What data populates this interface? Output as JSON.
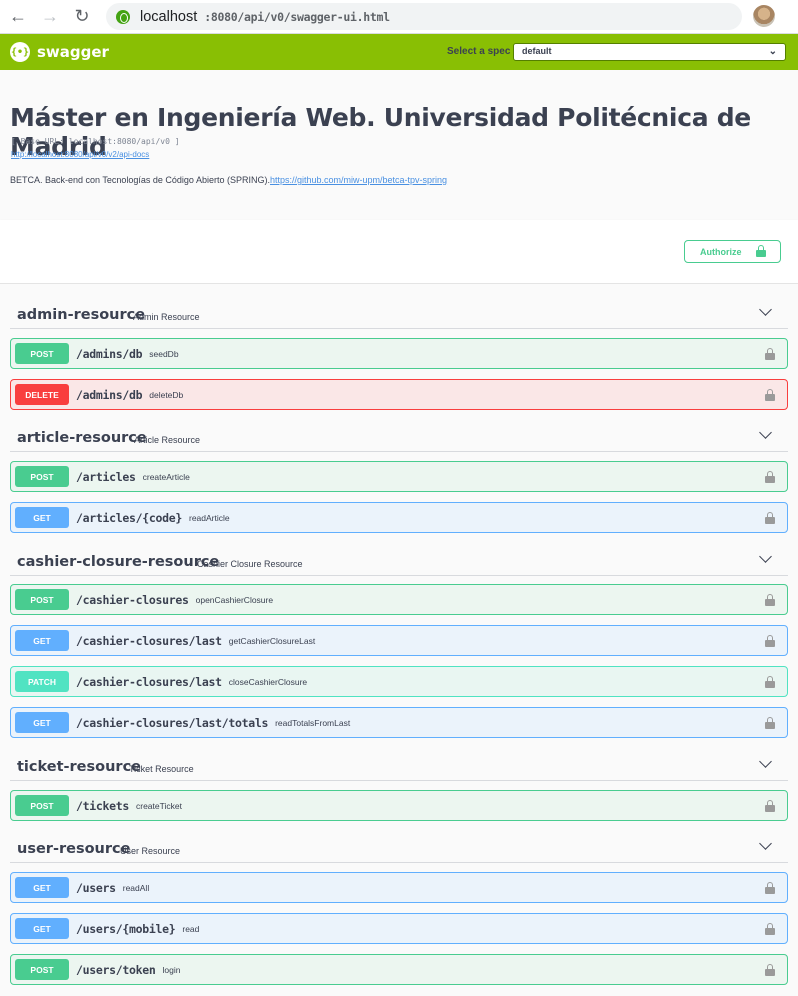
{
  "browser": {
    "url_host": "localhost",
    "url_path": ":8080/api/v0/swagger-ui.html"
  },
  "topbar": {
    "logo_text": "swagger",
    "spec_label": "Select a spec",
    "spec_value": "default"
  },
  "info": {
    "title": "Máster en Ingeniería Web. Universidad Politécnica de Madrid",
    "base_url": "[ Base URL: localhost:8080/api/v0 ]",
    "docs_url": "http://localhost:8080/api/v0/v2/api-docs",
    "description": "BETCA. Back-end con Tecnologías de Código Abierto (SPRING).",
    "description_link": "https://github.com/miw-upm/betca-tpv-spring"
  },
  "authorize_label": "Authorize",
  "tags": [
    {
      "name": "admin-resource",
      "description": "Admin Resource",
      "operations": [
        {
          "method": "POST",
          "path": "/admins/db",
          "summary": "seedDb"
        },
        {
          "method": "DELETE",
          "path": "/admins/db",
          "summary": "deleteDb"
        }
      ]
    },
    {
      "name": "article-resource",
      "description": "Article Resource",
      "operations": [
        {
          "method": "POST",
          "path": "/articles",
          "summary": "createArticle"
        },
        {
          "method": "GET",
          "path": "/articles/{code}",
          "summary": "readArticle"
        }
      ]
    },
    {
      "name": "cashier-closure-resource",
      "description": "Cashier Closure Resource",
      "operations": [
        {
          "method": "POST",
          "path": "/cashier-closures",
          "summary": "openCashierClosure"
        },
        {
          "method": "GET",
          "path": "/cashier-closures/last",
          "summary": "getCashierClosureLast"
        },
        {
          "method": "PATCH",
          "path": "/cashier-closures/last",
          "summary": "closeCashierClosure"
        },
        {
          "method": "GET",
          "path": "/cashier-closures/last/totals",
          "summary": "readTotalsFromLast"
        }
      ]
    },
    {
      "name": "ticket-resource",
      "description": "Ticket Resource",
      "operations": [
        {
          "method": "POST",
          "path": "/tickets",
          "summary": "createTicket"
        }
      ]
    },
    {
      "name": "user-resource",
      "description": "User Resource",
      "operations": [
        {
          "method": "GET",
          "path": "/users",
          "summary": "readAll"
        },
        {
          "method": "GET",
          "path": "/users/{mobile}",
          "summary": "read"
        },
        {
          "method": "POST",
          "path": "/users/token",
          "summary": "login"
        }
      ]
    }
  ]
}
